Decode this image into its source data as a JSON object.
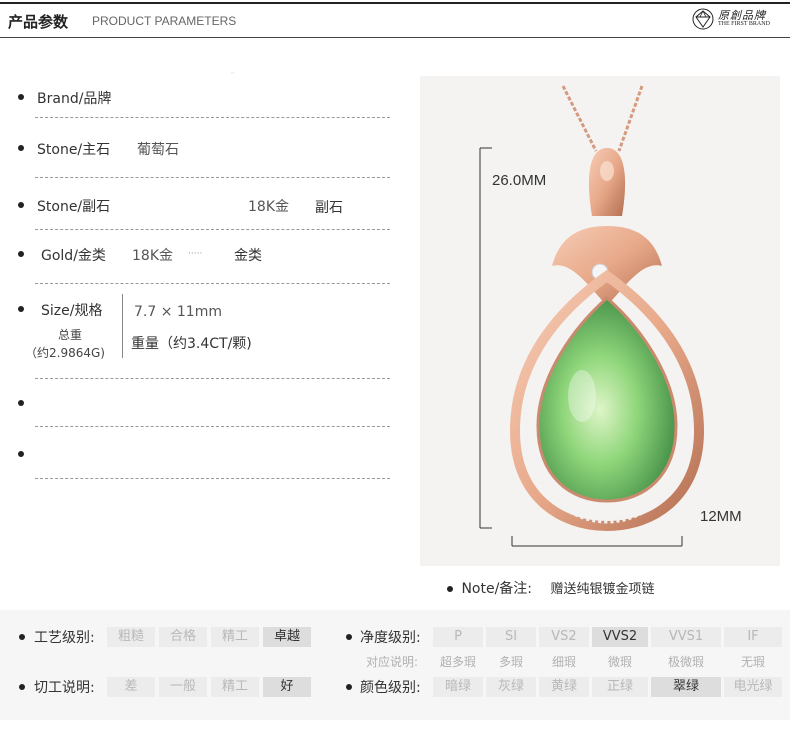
{
  "header": {
    "title_cn": "产品参数",
    "title_en": "PRODUCT PARAMETERS",
    "logo_cn": "原創品牌",
    "logo_en": "THE FIRST BRAND"
  },
  "specs": {
    "brand_label": "Brand/品牌",
    "stone_main_label": "Stone/主石",
    "stone_main_value": "葡萄石",
    "stone_side_label": "Stone/副石",
    "stone_side_value1": "18K金",
    "stone_side_value2": "副石",
    "gold_label": "Gold/金类",
    "gold_value1": "18K金",
    "gold_value2": "金类",
    "size_label": "Size/规格",
    "weight_label": "总重",
    "weight_total": "（约2.9864G)",
    "size_value": "7.7 × 11mm",
    "weight_value": "重量（约3.4CT/颗)"
  },
  "product": {
    "height_dim": "26.0MM",
    "width_dim": "12MM",
    "stone_color": "#8fd67a",
    "metal_color": "#e8a98a"
  },
  "note": {
    "label": "Note/备注:",
    "text": "赠送纯银镀金项链"
  },
  "grading": {
    "craft_label": "工艺级别:",
    "craft_options": [
      "粗糙",
      "合格",
      "精工",
      "卓越"
    ],
    "cut_label": "切工说明:",
    "cut_options": [
      "差",
      "一般",
      "精工",
      "好"
    ],
    "clarity_label": "净度级别:",
    "clarity_options": [
      "P",
      "SI",
      "VS2",
      "VVS2",
      "VVS1",
      "IF"
    ],
    "clarity_desc_label": "对应说明:",
    "clarity_desc": [
      "超多瑕",
      "多瑕",
      "细瑕",
      "微瑕",
      "极微瑕",
      "无瑕"
    ],
    "color_label": "颜色级别:",
    "color_options": [
      "暗绿",
      "灰绿",
      "黄绿",
      "正绿",
      "翠绿",
      "电光绿"
    ]
  }
}
